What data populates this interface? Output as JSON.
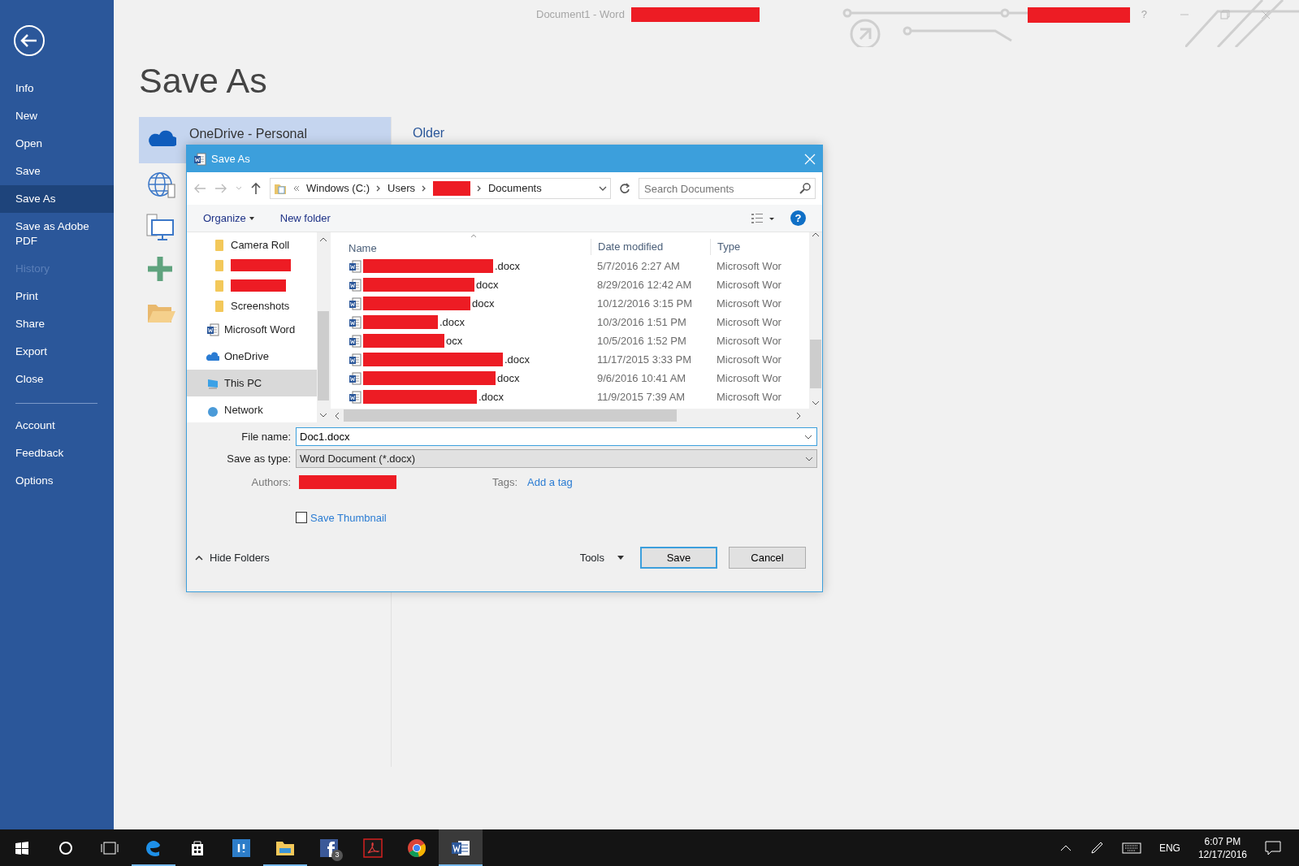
{
  "title_bar": {
    "title": "Document1  -  Word",
    "help": "?"
  },
  "backstage": {
    "menu": [
      {
        "label": "Info",
        "selected": false,
        "disabled": false
      },
      {
        "label": "New",
        "selected": false,
        "disabled": false
      },
      {
        "label": "Open",
        "selected": false,
        "disabled": false
      },
      {
        "label": "Save",
        "selected": false,
        "disabled": false
      },
      {
        "label": "Save As",
        "selected": true,
        "disabled": false
      },
      {
        "label": "Save as Adobe PDF",
        "selected": false,
        "disabled": false
      },
      {
        "label": "History",
        "selected": false,
        "disabled": true
      },
      {
        "label": "Print",
        "selected": false,
        "disabled": false
      },
      {
        "label": "Share",
        "selected": false,
        "disabled": false
      },
      {
        "label": "Export",
        "selected": false,
        "disabled": false
      },
      {
        "label": "Close",
        "selected": false,
        "disabled": false
      },
      {
        "label": "Account",
        "selected": false,
        "disabled": false,
        "kind": "footer"
      },
      {
        "label": "Feedback",
        "selected": false,
        "disabled": false,
        "kind": "footer"
      },
      {
        "label": "Options",
        "selected": false,
        "disabled": false,
        "kind": "footer"
      }
    ],
    "heading": "Save As",
    "places": [
      {
        "kind": "onedrive",
        "label": "OneDrive - Personal",
        "selected": true
      },
      {
        "kind": "web",
        "selected": false
      },
      {
        "kind": "pc",
        "selected": false
      },
      {
        "kind": "add",
        "selected": false
      },
      {
        "kind": "browse",
        "selected": false
      }
    ],
    "recent_heading": "Older"
  },
  "dialog": {
    "title": "Save As",
    "breadcrumb": [
      {
        "kind": "text",
        "text": "Windows (C:)"
      },
      {
        "kind": "text",
        "text": "Users"
      },
      {
        "kind": "redacted"
      },
      {
        "kind": "text",
        "text": "Documents"
      }
    ],
    "search": {
      "placeholder": "Search Documents"
    },
    "help": "?",
    "toolbar": [
      "Organize",
      "New folder"
    ],
    "nav_items": [
      {
        "kind": "folder",
        "label": "Camera Roll",
        "selected": false
      },
      {
        "kind": "folder",
        "redacted": true,
        "selected": false
      },
      {
        "kind": "folder",
        "redacted": true,
        "selected": false
      },
      {
        "kind": "folder",
        "label": "Screenshots",
        "selected": false
      },
      {
        "kind": "word",
        "label": "Microsoft Word",
        "selected": false
      },
      {
        "kind": "onedrive",
        "label": "OneDrive",
        "selected": false
      },
      {
        "kind": "pc",
        "label": "This PC",
        "selected": true
      },
      {
        "kind": "network",
        "label": "Network",
        "selected": false
      }
    ],
    "columns": [
      {
        "label": "Name",
        "sorted": true
      },
      {
        "label": "Date modified",
        "sorted": false
      },
      {
        "label": "Type",
        "sorted": false
      }
    ],
    "rows": [
      {
        "name_visible": ".docx",
        "date": "5/7/2016 2:27 AM",
        "type": "Microsoft Wor"
      },
      {
        "name_visible": "docx",
        "date": "8/29/2016 12:42 AM",
        "type": "Microsoft Wor"
      },
      {
        "name_visible": "docx",
        "date": "10/12/2016 3:15 PM",
        "type": "Microsoft Wor"
      },
      {
        "name_visible": ".docx",
        "date": "10/3/2016 1:51 PM",
        "type": "Microsoft Wor"
      },
      {
        "name_visible": "ocx",
        "date": "10/5/2016 1:52 PM",
        "type": "Microsoft Wor"
      },
      {
        "name_visible": ".docx",
        "date": "11/17/2015 3:33 PM",
        "type": "Microsoft Wor"
      },
      {
        "name_visible": "docx",
        "date": "9/6/2016 10:41 AM",
        "type": "Microsoft Wor"
      },
      {
        "name_visible": ".docx",
        "date": "11/9/2015 7:39 AM",
        "type": "Microsoft Wor"
      }
    ],
    "file_name": {
      "label": "File name:",
      "value": "Doc1.docx"
    },
    "save_type": {
      "label": "Save as type:",
      "value": "Word Document (*.docx)"
    },
    "authors": {
      "label": "Authors:"
    },
    "tags": {
      "label": "Tags:",
      "link": "Add a tag"
    },
    "thumbnail": {
      "label": "Save Thumbnail",
      "checked": false
    },
    "hide_folders": "Hide Folders",
    "tools": "Tools",
    "buttons": [
      {
        "label": "Save",
        "default": true
      },
      {
        "label": "Cancel",
        "default": false
      }
    ]
  },
  "taskbar": {
    "apps": [
      {
        "kind": "edge",
        "running": true,
        "active": false
      },
      {
        "kind": "store",
        "running": false,
        "active": false
      },
      {
        "kind": "app",
        "running": false,
        "active": false
      },
      {
        "kind": "explorer",
        "running": true,
        "active": false
      },
      {
        "kind": "facebook",
        "running": false,
        "active": false,
        "badge": "3"
      },
      {
        "kind": "pdf",
        "running": false,
        "active": false
      },
      {
        "kind": "chrome",
        "running": false,
        "active": false
      },
      {
        "kind": "word",
        "running": true,
        "active": true
      }
    ],
    "language": "ENG",
    "time": "6:07 PM",
    "date": "12/17/2016"
  }
}
